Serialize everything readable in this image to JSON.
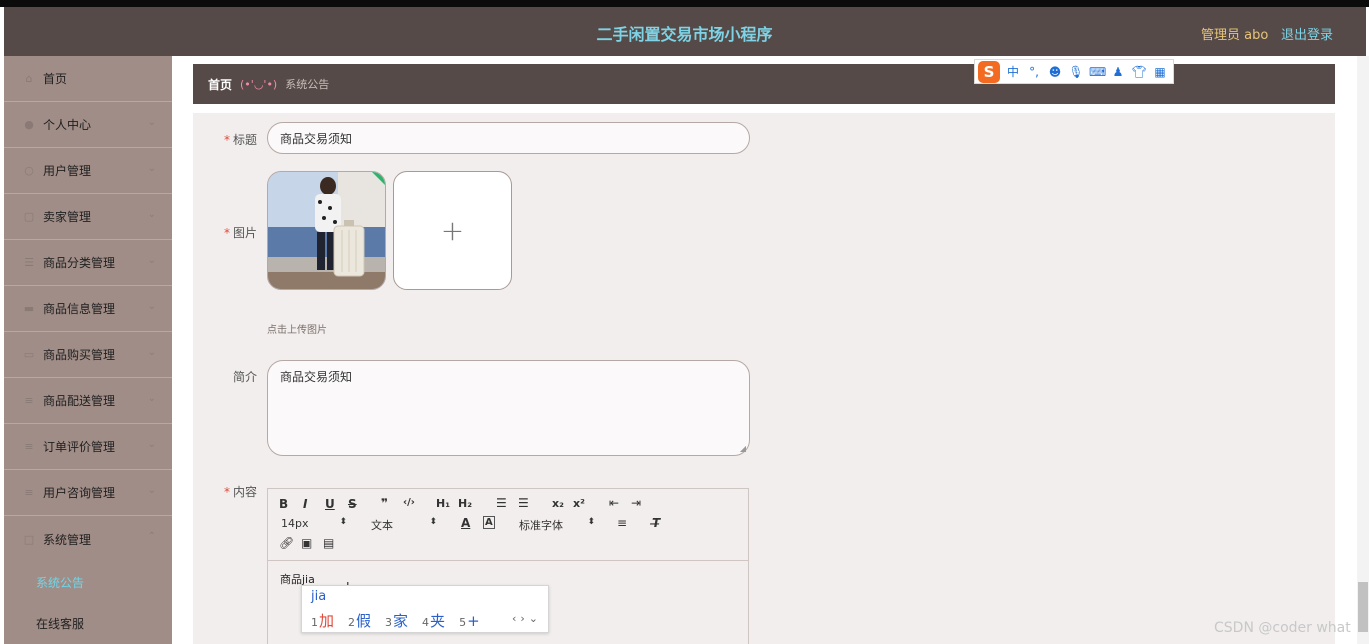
{
  "header": {
    "app_title": "二手闲置交易市场小程序",
    "admin_label": "管理员 abo",
    "logout_label": "退出登录"
  },
  "sidebar": {
    "items": [
      {
        "label": "首页",
        "icon": "home-icon"
      },
      {
        "label": "个人中心",
        "icon": "user-icon"
      },
      {
        "label": "用户管理",
        "icon": "users-icon"
      },
      {
        "label": "卖家管理",
        "icon": "store-icon"
      },
      {
        "label": "商品分类管理",
        "icon": "category-icon"
      },
      {
        "label": "商品信息管理",
        "icon": "goods-icon"
      },
      {
        "label": "商品购买管理",
        "icon": "cart-icon"
      },
      {
        "label": "商品配送管理",
        "icon": "delivery-icon"
      },
      {
        "label": "订单评价管理",
        "icon": "review-icon"
      },
      {
        "label": "用户咨询管理",
        "icon": "chat-icon"
      },
      {
        "label": "系统管理",
        "icon": "settings-icon"
      }
    ],
    "sub_items": [
      {
        "label": "系统公告",
        "active": true
      },
      {
        "label": "在线客服",
        "active": false
      }
    ]
  },
  "breadcrumb": {
    "home": "首页",
    "face": "(•'◡'•)",
    "current": "系统公告"
  },
  "form": {
    "title_label": "标题",
    "title_value": "商品交易须知",
    "image_label": "图片",
    "upload_hint": "点击上传图片",
    "intro_label": "简介",
    "intro_value": "商品交易须知",
    "content_label": "内容"
  },
  "editor": {
    "font_size": "14px",
    "text_style": "文本",
    "font_family": "标准字体",
    "content_text": "商品jia"
  },
  "ime": {
    "pinyin": "jia",
    "candidates": [
      {
        "num": "1",
        "char": "加"
      },
      {
        "num": "2",
        "char": "假"
      },
      {
        "num": "3",
        "char": "家"
      },
      {
        "num": "4",
        "char": "夹"
      },
      {
        "num": "5",
        "char": "+"
      }
    ],
    "toolbar_mode": "中",
    "toolbar_punct": "°,"
  },
  "watermark": "CSDN @coder what"
}
